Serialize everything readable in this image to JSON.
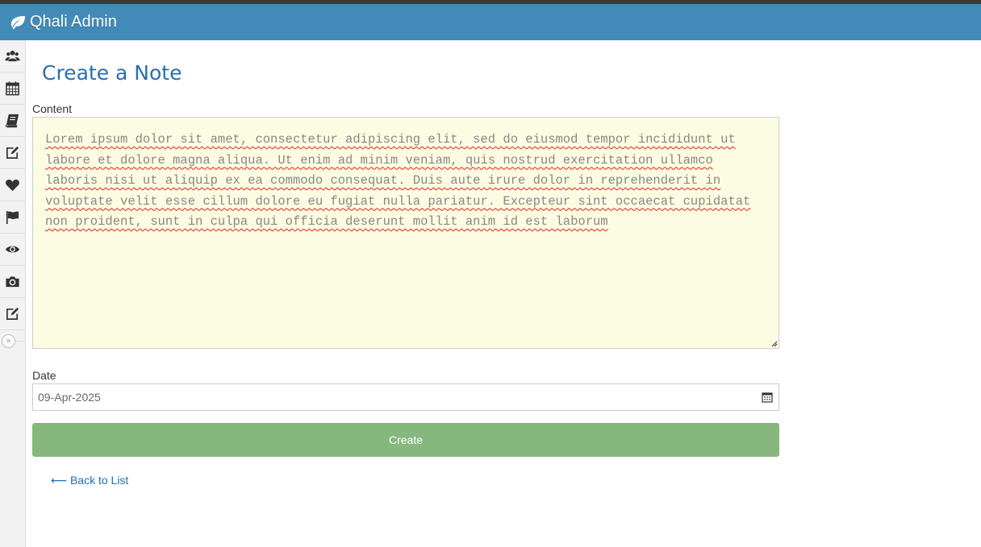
{
  "navbar": {
    "brand": "Qhali Admin",
    "brand_icon": "leaf-icon",
    "color": "#428bb9"
  },
  "sidebar": {
    "items": [
      {
        "icon": "users-icon"
      },
      {
        "icon": "calendar-icon"
      },
      {
        "icon": "book-icon"
      },
      {
        "icon": "edit-icon"
      },
      {
        "icon": "heart-icon"
      },
      {
        "icon": "flag-icon"
      },
      {
        "icon": "eye-icon"
      },
      {
        "icon": "camera-icon"
      },
      {
        "icon": "edit-icon"
      }
    ],
    "toggle_glyph": "»"
  },
  "page": {
    "title": "Create a Note"
  },
  "form": {
    "content_label": "Content",
    "content_value": "Lorem ipsum dolor sit amet, consectetur adipiscing elit, sed do eiusmod tempor incididunt ut labore et dolore magna aliqua. Ut enim ad minim veniam, quis nostrud exercitation ullamco laboris nisi ut aliquip ex ea commodo consequat. Duis aute irure dolor in reprehenderit in voluptate velit esse cillum dolore eu fugiat nulla pariatur. Excepteur sint occaecat cupidatat non proident, sunt in culpa qui officia deserunt mollit anim id est laborum",
    "date_label": "Date",
    "date_value": "09-Apr-2025",
    "submit_label": "Create",
    "submit_color": "#86b87e"
  },
  "back_link": {
    "label": "⟵ Back to List"
  }
}
